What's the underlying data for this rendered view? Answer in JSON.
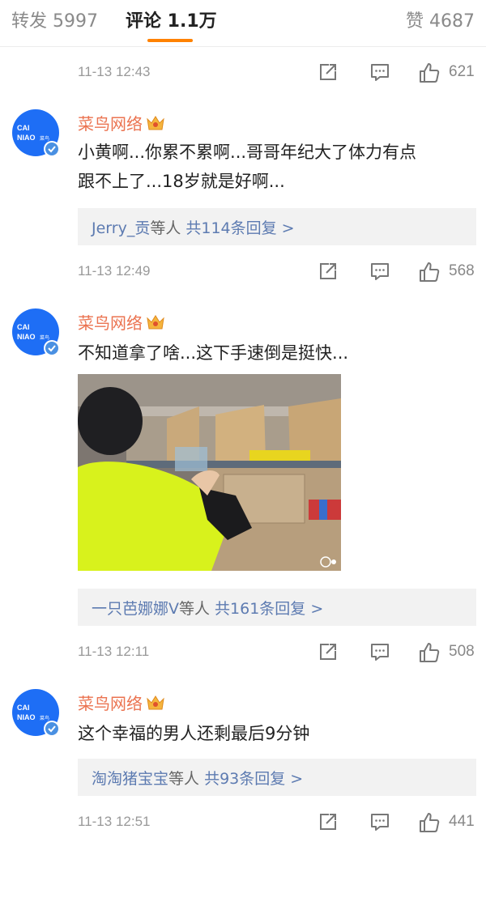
{
  "tabs": {
    "repost": "转发 5997",
    "comments": "评论 1.1万",
    "likes": "赞 4687"
  },
  "top_meta": {
    "time": "11-13 12:43",
    "likes": "621"
  },
  "comments": [
    {
      "user": "菜鸟网络",
      "avatar_text": [
        "CAI",
        "NIAO",
        "菜鸟"
      ],
      "text_lines": [
        "小黄啊...你累不累啊...哥哥年纪大了体力有点",
        "跟不上了...18岁就是好啊..."
      ],
      "reply": {
        "users": "Jerry_贡",
        "suffix": "等人 ",
        "count": "共114条回复",
        "arrow": ">"
      },
      "time": "11-13 12:49",
      "likes": "568"
    },
    {
      "user": "菜鸟网络",
      "avatar_text": [
        "CAI",
        "NIAO",
        "菜鸟"
      ],
      "text_lines": [
        "不知道拿了啥...这下手速倒是挺快..."
      ],
      "has_image": true,
      "reply": {
        "users": "一只芭娜娜V",
        "suffix": "等人 ",
        "count": "共161条回复",
        "arrow": ">"
      },
      "time": "11-13 12:11",
      "likes": "508"
    },
    {
      "user": "菜鸟网络",
      "avatar_text": [
        "CAI",
        "NIAO",
        "菜鸟"
      ],
      "text_lines": [
        "这个幸福的男人还剩最后9分钟"
      ],
      "reply": {
        "users": "淘淘猪宝宝",
        "suffix": "等人 ",
        "count": "共93条回复",
        "arrow": ">"
      },
      "time": "11-13 12:51",
      "likes": "441"
    }
  ],
  "icons": {
    "share": "share-icon",
    "comment": "comment-icon",
    "like": "thumbs-up-icon",
    "crown": "vip-crown-icon",
    "verified": "verified-badge-icon"
  },
  "colors": {
    "accent": "#ff8200",
    "username": "#eb7350",
    "reply_link": "#5d7bb1",
    "avatar_blue": "#1e6ef5"
  }
}
